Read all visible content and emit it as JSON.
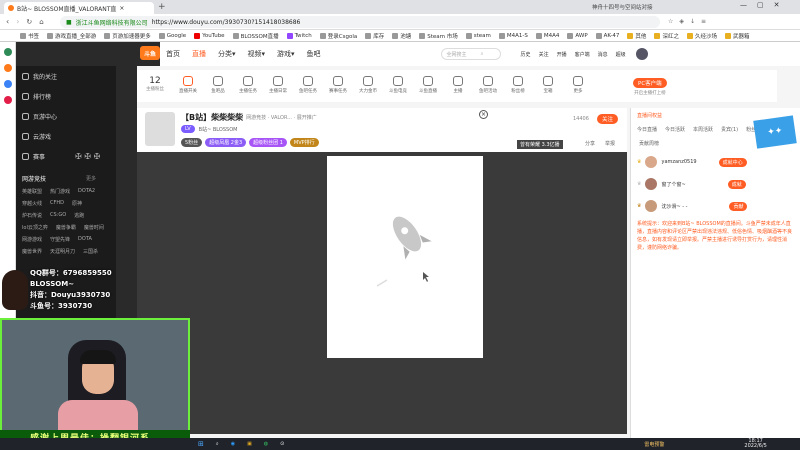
{
  "browser": {
    "tab_title": "B站~ BLOSSOM直播_VALORANT直",
    "security_text": "浙江斗鱼网络科技有限公司",
    "url": "https://www.douyu.com/3930730?151418038686",
    "right_tab_hint": "神舟十四号与空间站对接",
    "bookmarks": [
      "书签",
      "游戏直播_全部游",
      "页游加速器更多",
      "Google",
      "YouTube",
      "BLOSSOM直播",
      "Twitch",
      "登录Csgola",
      "库存",
      "池塘",
      "Steam 市场",
      "steam",
      "M4A1-S",
      "M4A4",
      "AWP",
      "AK-47",
      "其他",
      "深红之",
      "久经沙场",
      "武器箱"
    ]
  },
  "site": {
    "logo": "斗鱼",
    "nav": [
      "首页",
      "直播",
      "分类",
      "视频",
      "游戏",
      "鱼吧"
    ],
    "search_placeholder": "全网搜主",
    "user_actions": [
      "历史",
      "关注",
      "开播",
      "客户端",
      "消息",
      "超级"
    ],
    "stat_count": "12",
    "stat_label": "主播粉丝",
    "categories": [
      "直播开关",
      "鱼吧品",
      "主播任务",
      "主播日常",
      "鱼吧任务",
      "赛事任务",
      "大力金币",
      "斗鱼电竞",
      "斗鱼直播",
      "主播",
      "鱼吧活动",
      "粉丝榜",
      "宝箱",
      "更多"
    ],
    "pc_client": "PC客户端",
    "pc_client_sub": "开启主播打上榜"
  },
  "sidebar": {
    "items": [
      "我的关注",
      "排行榜",
      "页游中心",
      "云游戏",
      "赛事"
    ],
    "section_title": "网游竞技",
    "section_more": "更多",
    "grid": [
      [
        "英雄联盟",
        "热门游戏",
        "DOTA2"
      ],
      [
        "穿越火线",
        "CFHD",
        "原神"
      ],
      [
        "炉石传说",
        "CS:GO",
        "逃跑"
      ],
      [
        "lol云顶之弈",
        "魔兽争霸",
        "魔兽时间"
      ],
      [
        "网游游戏",
        "守望先锋",
        "DOTA"
      ],
      [
        "魔兽世界",
        "天涯明月刀",
        "三国杀"
      ]
    ]
  },
  "room": {
    "title": "【B站】柴柴柴柴",
    "category": "网游竞技 · VALOR... · 展开推广",
    "anchor": "B站~ BLOSSOM",
    "level_badge": "LV",
    "tags": [
      "5粉丝",
      "超级凤凰 2金3",
      "超级粉丝团 1",
      "MVP排行"
    ],
    "hot_count": "14406",
    "follow_label": "关注",
    "rank_label": "曾有荣耀 3.3亿播",
    "share_label": "分享",
    "report_label": "举报",
    "close_label": "×"
  },
  "chat": {
    "tabs": [
      "直播间权益",
      "今日直播",
      "今日活跃",
      "本周活跃",
      "贵宾(1)",
      "粉丝"
    ],
    "contribution_title": "贡献周榜",
    "notice": "系统提示：欢迎来到B站~ BLOSSOM的直播间。斗鱼严禁未成年人直播，直播内容和评论区严禁出现违法违规、低俗色情、吸烟酗酒等不良信息，如有发现请立即举报。严禁主播进行诱导打赏行为，请理性消费，谨防网络诈骗。",
    "users": [
      {
        "name": "yamzanz0519",
        "badge": "成就中心"
      },
      {
        "name": "窗了个窗~",
        "badge": "成就"
      },
      {
        "name": "沈沙滑~ - -",
        "badge": "贡献"
      }
    ]
  },
  "overlay": {
    "lines": [
      "QQ群号：6796859550",
      "BLOSSOM~",
      "抖音：Douyu3930730",
      "斗鱼号：3930730"
    ],
    "ticker": "感谢上周最佳：操翻银河系"
  },
  "taskbar": {
    "time": "18:17",
    "date": "2022/6/5",
    "weather": "雷电预警"
  }
}
